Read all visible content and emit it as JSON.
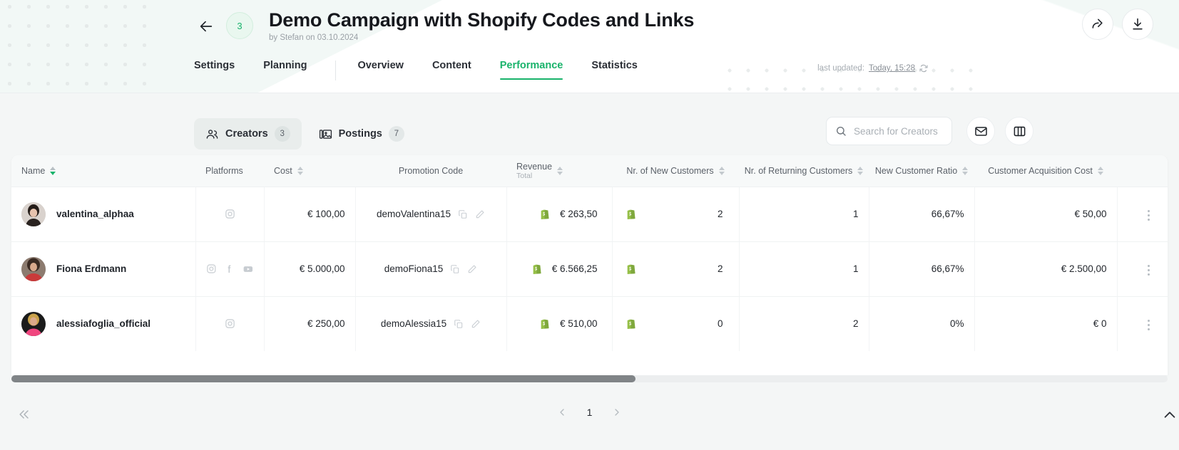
{
  "header": {
    "back_icon": "arrow-left-icon",
    "count_badge": "3",
    "title": "Demo Campaign with Shopify Codes and Links",
    "subtitle": "by Stefan on 03.10.2024",
    "share_icon": "share-arrow-icon",
    "download_icon": "download-icon",
    "last_updated_label": "last updated:",
    "last_updated_time": "Today, 15:28",
    "refresh_icon": "refresh-icon"
  },
  "tabs": {
    "left": [
      {
        "label": "Settings",
        "active": false
      },
      {
        "label": "Planning",
        "active": false
      }
    ],
    "right": [
      {
        "label": "Overview",
        "active": false
      },
      {
        "label": "Content",
        "active": false
      },
      {
        "label": "Performance",
        "active": true
      },
      {
        "label": "Statistics",
        "active": false
      }
    ]
  },
  "toolbar": {
    "pills": [
      {
        "label": "Creators",
        "count": "3",
        "icon": "people-icon",
        "selected": true
      },
      {
        "label": "Postings",
        "count": "7",
        "icon": "images-icon",
        "selected": false
      }
    ],
    "search": {
      "placeholder": "Search for Creators",
      "value": "",
      "icon": "search-icon"
    },
    "mail_button_icon": "envelope-icon",
    "columns_button_icon": "columns-layout-icon"
  },
  "table": {
    "columns": [
      {
        "key": "name",
        "label": "Name",
        "sub": "",
        "sortable": true,
        "sort_state": "desc",
        "align": "left"
      },
      {
        "key": "platforms",
        "label": "Platforms",
        "sub": "",
        "sortable": false,
        "align": "center"
      },
      {
        "key": "cost",
        "label": "Cost",
        "sub": "",
        "sortable": true,
        "sort_state": "none",
        "align": "right"
      },
      {
        "key": "promotion_code",
        "label": "Promotion Code",
        "sub": "",
        "sortable": false,
        "align": "center"
      },
      {
        "key": "revenue",
        "label": "Revenue",
        "sub": "Total",
        "sortable": true,
        "sort_state": "none",
        "align": "right"
      },
      {
        "key": "new_customers",
        "label": "Nr. of New Customers",
        "sub": "",
        "sortable": true,
        "sort_state": "none",
        "align": "right"
      },
      {
        "key": "returning_customers",
        "label": "Nr. of Returning Customers",
        "sub": "",
        "sortable": true,
        "sort_state": "none",
        "align": "right"
      },
      {
        "key": "new_customer_ratio",
        "label": "New Customer Ratio",
        "sub": "",
        "sortable": true,
        "sort_state": "none",
        "align": "right"
      },
      {
        "key": "cac",
        "label": "Customer Acquisition Cost",
        "sub": "",
        "sortable": true,
        "sort_state": "none",
        "align": "right"
      }
    ],
    "rows": [
      {
        "name": "valentina_alphaa",
        "platforms": [
          "instagram-icon"
        ],
        "cost": "€ 100,00",
        "promotion_code": "demoValentina15",
        "copy_icon": "copy-icon",
        "edit_icon": "pencil-icon",
        "revenue_source_icon": "shopify-icon",
        "revenue": "€ 263,50",
        "new_customers_source_icon": "shopify-icon",
        "new_customers": "2",
        "returning_customers": "1",
        "new_customer_ratio": "66,67%",
        "cac": "€ 50,00",
        "menu_icon": "kebab-menu-icon"
      },
      {
        "name": "Fiona Erdmann",
        "platforms": [
          "instagram-icon",
          "facebook-icon",
          "youtube-icon"
        ],
        "cost": "€ 5.000,00",
        "promotion_code": "demoFiona15",
        "copy_icon": "copy-icon",
        "edit_icon": "pencil-icon",
        "revenue_source_icon": "shopify-icon",
        "revenue": "€ 6.566,25",
        "new_customers_source_icon": "shopify-icon",
        "new_customers": "2",
        "returning_customers": "1",
        "new_customer_ratio": "66,67%",
        "cac": "€ 2.500,00",
        "menu_icon": "kebab-menu-icon"
      },
      {
        "name": "alessiafoglia_official",
        "platforms": [
          "instagram-icon"
        ],
        "cost": "€ 250,00",
        "promotion_code": "demoAlessia15",
        "copy_icon": "copy-icon",
        "edit_icon": "pencil-icon",
        "revenue_source_icon": "shopify-icon",
        "revenue": "€ 510,00",
        "new_customers_source_icon": "shopify-icon",
        "new_customers": "0",
        "returning_customers": "2",
        "new_customer_ratio": "0%",
        "cac": "€ 0",
        "menu_icon": "kebab-menu-icon"
      }
    ]
  },
  "footer": {
    "collapse_icon": "chevrons-left-icon",
    "prev_icon": "chevron-left-icon",
    "current_page": "1",
    "next_icon": "chevron-right-icon",
    "scroll_top_icon": "chevron-up-icon"
  },
  "colors": {
    "accent_green": "#19b36b",
    "shopify_green": "#95bf47",
    "page_bg": "#f4f6f6",
    "card_bg": "#ffffff"
  }
}
